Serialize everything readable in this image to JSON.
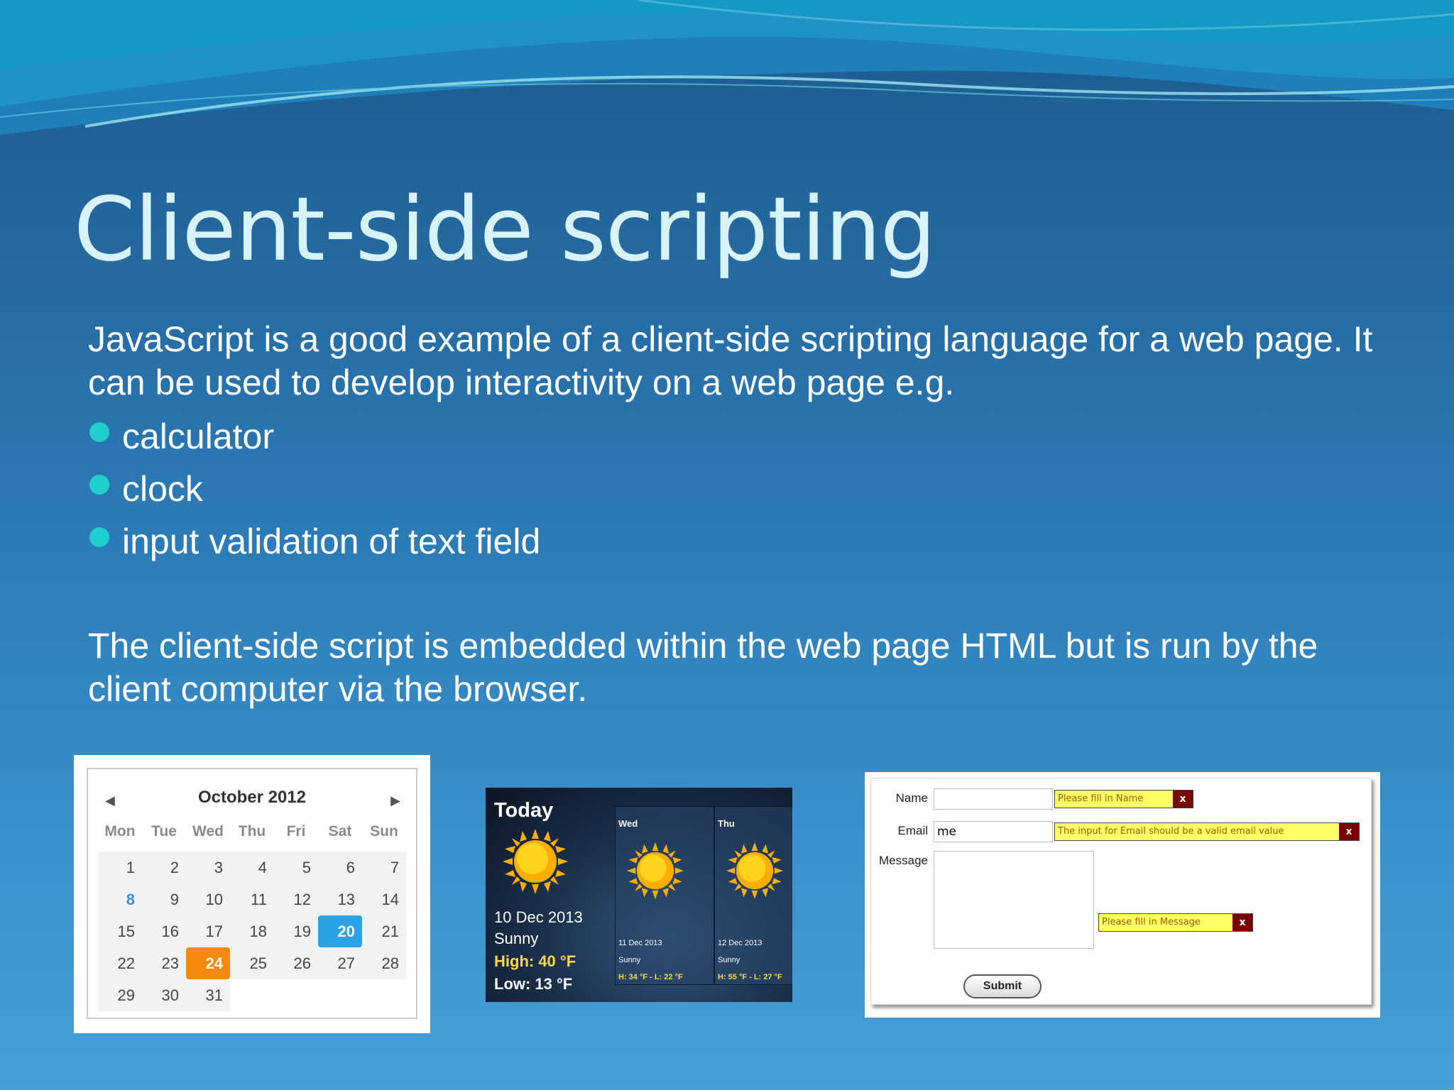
{
  "slide": {
    "title": "Client-side scripting",
    "intro": "JavaScript is a good example of a client-side scripting language for a web page. It can be used to develop interactivity on a web page e.g.",
    "bullets": [
      "calculator",
      "clock",
      "input validation of text field"
    ],
    "closing": "The client-side script is embedded within the web page HTML but is run by the client computer via the browser."
  },
  "calendar": {
    "month_label": "October 2012",
    "prev_symbol": "◀",
    "next_symbol": "▶",
    "weekdays": [
      "Mon",
      "Tue",
      "Wed",
      "Thu",
      "Fri",
      "Sat",
      "Sun"
    ],
    "weeks": [
      [
        "1",
        "2",
        "3",
        "4",
        "5",
        "6",
        "7"
      ],
      [
        "8",
        "9",
        "10",
        "11",
        "12",
        "13",
        "14"
      ],
      [
        "15",
        "16",
        "17",
        "18",
        "19",
        "20",
        "21"
      ],
      [
        "22",
        "23",
        "24",
        "25",
        "26",
        "27",
        "28"
      ],
      [
        "29",
        "30",
        "31",
        "",
        "",
        "",
        ""
      ]
    ],
    "highlighted_day": "8",
    "today_day": "20",
    "selected_day": "24",
    "colors": {
      "today": "#2ba1e6",
      "selected": "#f48a0f",
      "highlight_text": "#3d8fd6"
    }
  },
  "weather": {
    "today_label": "Today",
    "date": "10 Dec 2013",
    "condition": "Sunny",
    "high": "High: 40 °F",
    "low": "Low:  13 °F",
    "icon": "sun-icon",
    "forecast": [
      {
        "day": "Wed",
        "date": "11 Dec 2013",
        "condition": "Sunny",
        "temps": "H: 34 °F - L: 22 °F"
      },
      {
        "day": "Thu",
        "date": "12 Dec 2013",
        "condition": "Sunny",
        "temps": "H: 55 °F - L: 27 °F"
      }
    ]
  },
  "form": {
    "name_label": "Name",
    "name_value": "",
    "name_error": "Please fill in Name",
    "email_label": "Email",
    "email_value": "me",
    "email_error": "The input for Email should be a valid email value",
    "message_label": "Message",
    "message_value": "",
    "message_error": "Please fill in Message",
    "close_symbol": "x",
    "submit_label": "Submit"
  },
  "colors": {
    "title": "#d9f3fa",
    "bullet": "#1fcfcd",
    "error_bg": "#ffff66",
    "error_close_bg": "#7a0000"
  }
}
